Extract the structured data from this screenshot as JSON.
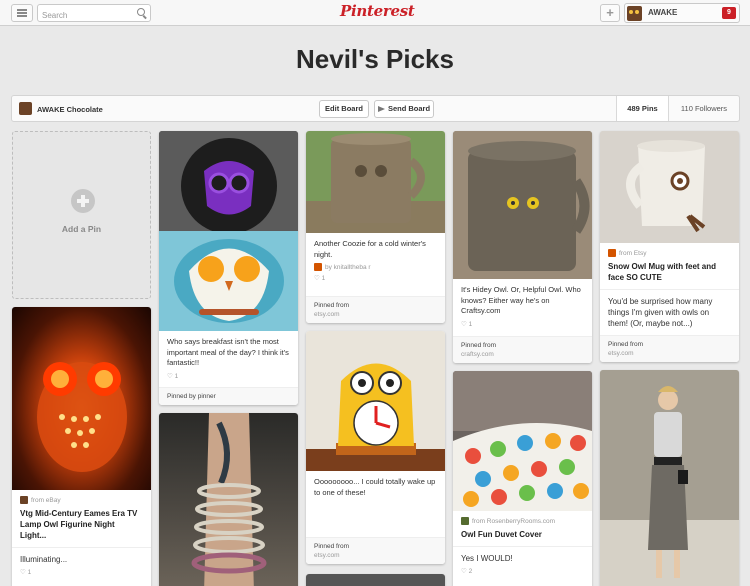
{
  "header": {
    "search_placeholder": "Search",
    "logo": "Pinterest",
    "user_name": "AWAKE",
    "notification_count": "9"
  },
  "board": {
    "title": "Nevil's Picks",
    "owner": "AWAKE Chocolate",
    "edit_label": "Edit Board",
    "send_label": "Send Board",
    "pins_count": "489 Pins",
    "followers_count": "110 Followers"
  },
  "add_pin": {
    "label": "Add a Pin"
  },
  "pins": [
    {
      "id": "owl-lamp",
      "source": "from eBay",
      "title": "Vtg Mid-Century Eames Era TV Lamp Owl Figurine Night Light...",
      "body": "Illuminating...",
      "likes": "1"
    },
    {
      "id": "owl-egg",
      "description": "Who says breakfast isn't the most important meal of the day? I think it's fantastic!!",
      "likes": "1",
      "footer_label": "Pinned by",
      "footer_source": "pinner"
    },
    {
      "id": "owl-bracelets"
    },
    {
      "id": "coozie",
      "description": "Another Coozie for a cold winter's night.",
      "by": "by knitalltheba r",
      "likes": "1",
      "footer_label": "Pinned from",
      "footer_source": "etsy.com"
    },
    {
      "id": "owl-clock",
      "description": "Ooooooooo... I could totally wake up to one of these!",
      "footer_label": "Pinned from",
      "footer_source": "etsy.com"
    },
    {
      "id": "hidey-owl",
      "description": "It's Hidey Owl. Or, Helpful Owl. Who knows? Either way he's on Craftsy.com",
      "likes": "1",
      "footer_label": "Pinned from",
      "footer_source": "craftsy.com"
    },
    {
      "id": "duvet",
      "source": "from RosenberryRooms.com",
      "title": "Owl Fun Duvet Cover",
      "body": "Yes I WOULD!",
      "likes": "2"
    },
    {
      "id": "owl-mug",
      "source": "from Etsy",
      "title": "Snow Owl Mug with feet and face SO CUTE",
      "body": "You'd be surprised how many things I'm given with owls on them! (Or, maybe not...)",
      "footer_label": "Pinned from",
      "footer_source": "etsy.com"
    },
    {
      "id": "owl-dress"
    }
  ],
  "colors": {
    "brand": "#cb2027",
    "background": "#e9e9e9"
  },
  "icons": [
    "menu-icon",
    "search-icon",
    "plus-icon",
    "send-icon",
    "heart-icon"
  ]
}
